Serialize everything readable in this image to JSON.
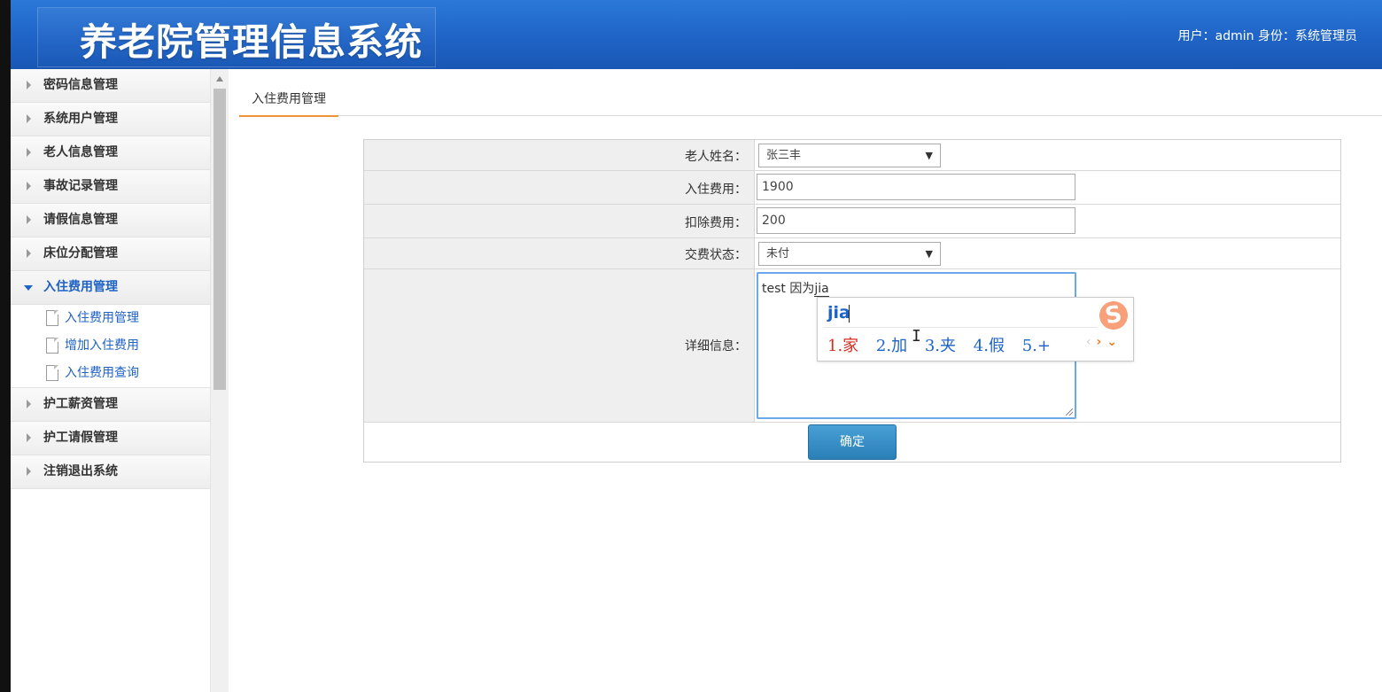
{
  "header": {
    "title": "养老院管理信息系统",
    "user_info": "用户：admin 身份：系统管理员"
  },
  "sidebar": {
    "items": [
      {
        "label": "密码信息管理"
      },
      {
        "label": "系统用户管理"
      },
      {
        "label": "老人信息管理"
      },
      {
        "label": "事故记录管理"
      },
      {
        "label": "请假信息管理"
      },
      {
        "label": "床位分配管理"
      },
      {
        "label": "入住费用管理",
        "expanded": true,
        "children": [
          {
            "label": "入住费用管理"
          },
          {
            "label": "增加入住费用"
          },
          {
            "label": "入住费用查询"
          }
        ]
      },
      {
        "label": "护工薪资管理"
      },
      {
        "label": "护工请假管理"
      },
      {
        "label": "注销退出系统"
      }
    ]
  },
  "tab": {
    "label": "入住费用管理"
  },
  "form": {
    "elder_name_label": "老人姓名：",
    "elder_name_value": "张三丰",
    "fee_label": "入住费用：",
    "fee_value": "1900",
    "deduct_label": "扣除费用：",
    "deduct_value": "200",
    "status_label": "交费状态：",
    "status_value": "未付",
    "detail_label": "详细信息：",
    "detail_text": "test  因为",
    "detail_composing": "jia",
    "submit_label": "确定"
  },
  "ime": {
    "composition": "jia",
    "candidates": [
      "1.家",
      "2.加",
      "3.夹",
      "4.假",
      "5.+"
    ],
    "logo_text": "S",
    "prev_glyph": "‹",
    "next_glyph": "›",
    "more_glyph": "⌄"
  },
  "colors": {
    "header_blue": "#1e62c4",
    "active_menu": "#1e62c4",
    "tab_underline": "#f0923a",
    "button_blue": "#2a7fb7",
    "ime_first_candidate": "#d82c1e"
  }
}
